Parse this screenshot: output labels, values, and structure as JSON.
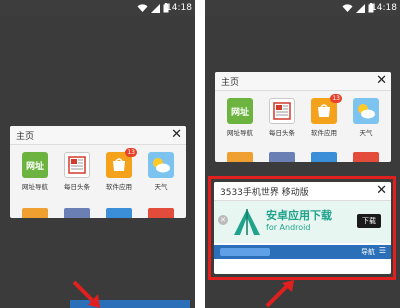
{
  "status_bar": {
    "time": "14:18",
    "icons": [
      "notification-icon",
      "wifi-icon",
      "signal-icon",
      "battery-icon"
    ]
  },
  "left_panel": {
    "card": {
      "title": "主页",
      "close": "✕",
      "apps": [
        {
          "label": "网址导航",
          "tile_text": "网址",
          "icon": "web-directory-icon",
          "color": "#6cb33f"
        },
        {
          "label": "每日头条",
          "tile_text": "",
          "icon": "newspaper-icon",
          "color": "#e7e7e7"
        },
        {
          "label": "软件应用",
          "tile_text": "",
          "icon": "shopping-bag-icon",
          "color": "#f4a21c",
          "badge": "13"
        },
        {
          "label": "天气",
          "tile_text": "",
          "icon": "weather-icon",
          "color": "#7cc3f0"
        }
      ]
    }
  },
  "right_panel": {
    "card_home": {
      "title": "主页",
      "close": "✕",
      "apps": [
        {
          "label": "网址导航",
          "tile_text": "网址",
          "icon": "web-directory-icon",
          "color": "#6cb33f"
        },
        {
          "label": "每日头条",
          "tile_text": "",
          "icon": "newspaper-icon",
          "color": "#e7e7e7"
        },
        {
          "label": "软件应用",
          "tile_text": "",
          "icon": "shopping-bag-icon",
          "color": "#f4a21c",
          "badge": "13"
        },
        {
          "label": "天气",
          "tile_text": "",
          "icon": "weather-icon",
          "color": "#7cc3f0"
        }
      ]
    },
    "card_site": {
      "title": "3533手机世界 移动版",
      "close": "✕",
      "ad_title": "安卓应用下载",
      "ad_sub": "for Android",
      "ad_button": "下载",
      "nav_label": "导航"
    }
  },
  "colors": {
    "dark_bg": "#3b3b3b",
    "highlight": "#e01f1f",
    "ad_green": "#1fa38a",
    "nav_blue": "#2a6fb8"
  }
}
